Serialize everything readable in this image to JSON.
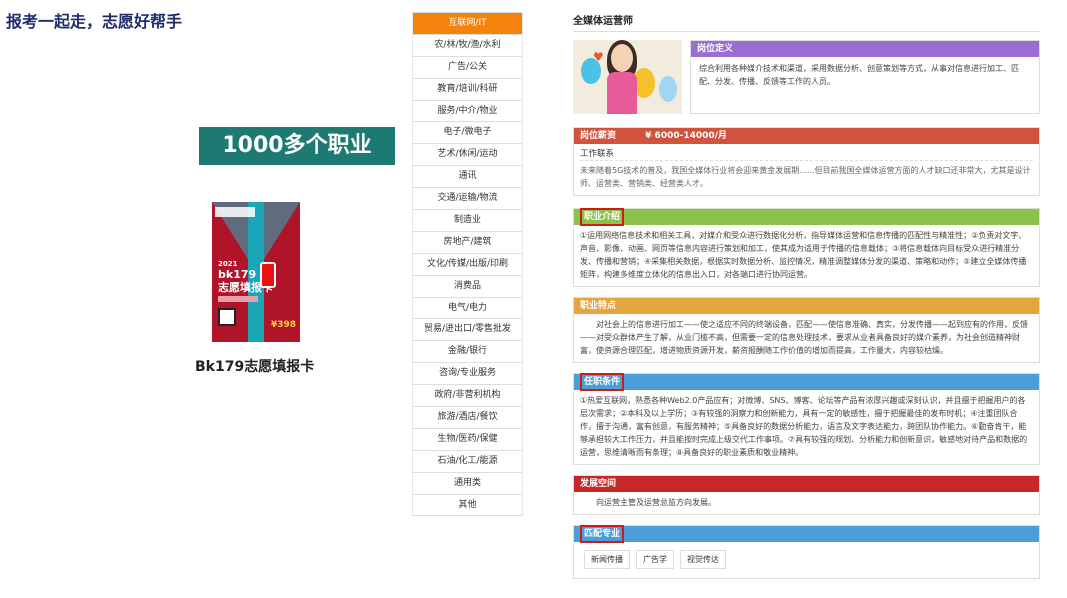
{
  "header": {
    "title": "报考一起走，志愿好帮手"
  },
  "promo": {
    "banner": "1000多个职业",
    "card_year": "2021",
    "card_name": "bk179\n志愿填报卡",
    "card_price": "¥398",
    "card_caption": "Bk179志愿填报卡"
  },
  "nav": {
    "active_index": 0,
    "items": [
      "互联网/IT",
      "农/林/牧/渔/水利",
      "广告/公关",
      "教育/培训/科研",
      "服务/中介/物业",
      "电子/微电子",
      "艺术/休闲/运动",
      "通讯",
      "交通/运输/物流",
      "制造业",
      "房地产/建筑",
      "文化/传媒/出版/印刷",
      "消费品",
      "电气/电力",
      "贸易/进出口/零售批发",
      "金融/银行",
      "咨询/专业服务",
      "政府/非营利机构",
      "旅游/酒店/餐饮",
      "生物/医药/保健",
      "石油/化工/能源",
      "通用类",
      "其他"
    ]
  },
  "job": {
    "title": "全媒体运营师",
    "definition": {
      "heading": "岗位定义",
      "text": "综合利用各种媒介技术和渠道，采用数据分析、创意策划等方式，从事对信息进行加工、匹配、分发、传播、反馈等工作的人员。"
    },
    "salary": {
      "heading": "岗位薪资",
      "value": "¥ 6000-14000/月",
      "subheading": "工作联系",
      "text": "未来随着5G技术的普及，我国全媒体行业将会迎来黄金发展期......但目前我国全媒体运营方面的人才缺口还非常大，尤其是设计师、运营类、营销类、经营类人才。"
    },
    "intro": {
      "heading": "职业介绍",
      "text": "①运用网络信息技术和相关工具，对媒介和受众进行数据化分析，指导媒体运营和信息传播的匹配性与精准性；②负责对文字、声音、影像、动画、网页等信息内容进行策划和加工，使其成为适用于传播的信息载体；③将信息载体向目标受众进行精准分发、传播和营销；④采集相关数据，根据实时数据分析、监控情况，精准调整媒体分发的渠道、策略和动作；⑤建立全媒体传播矩阵，构建多维度立体化的信息出入口，对各端口进行协同运营。"
    },
    "features": {
      "heading": "职业特点",
      "text": "对社会上的信息进行加工——使之适应不同的终端设备，匹配——使信息准确、真实，分发传播——起到应有的作用，反馈——对受众群体产生了解，从业门槛不高，但需要一定的信息处理技术，要求从业者具备良好的媒介素养，为社会创造精神财富，使资源合理匹配，增进物质资源开发，薪资报酬随工作价值的增加而提高，工作量大，内容较枯燥。"
    },
    "requirements": {
      "heading": "任职条件",
      "text": "①热爱互联网，熟悉各种Web2.0产品应有；对微博、SNS、博客、论坛等产品有浓厚兴趣或深刻认识，并且擅于把握用户的各层次需求；②本科及以上学历；③有较强的洞察力和创新能力，具有一定的敏感性，擅于把握最佳的发布时机；④注重团队合作，擅于沟通，富有创意，有服务精神；⑤具备良好的数据分析能力，语言及文字表达能力，跨团队协作能力。⑥勤奋肯干，能够承担较大工作压力，并且能按时完成上级交代工作事项。⑦具有较强的规划、分析能力和创新意识，敏感地对待产品和数据的运营，思维清晰而有条理；⑧具备良好的职业素质和敬业精神。"
    },
    "development": {
      "heading": "发展空间",
      "text": "向运营主管及运营总监方向发展。"
    },
    "majors": {
      "heading": "匹配专业",
      "items": [
        "新闻传播",
        "广告学",
        "视觉传达"
      ]
    }
  },
  "colors": {
    "nav_active": "#f5820d",
    "banner": "#1d7a73",
    "definition": "#9b6ed3",
    "salary": "#d2533d",
    "intro": "#8bc34a",
    "features": "#e3a53c",
    "requirements": "#4a9fd8",
    "development": "#c62828",
    "majors": "#4a9fd8"
  }
}
